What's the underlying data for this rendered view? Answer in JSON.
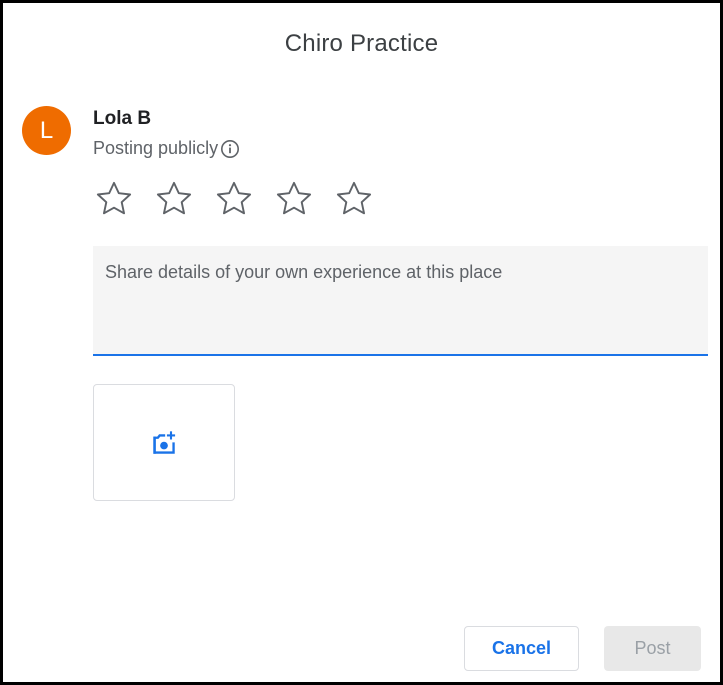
{
  "dialog": {
    "title": "Chiro Practice"
  },
  "user": {
    "avatar_initial": "L",
    "avatar_color": "#ef6c00",
    "name": "Lola B",
    "posting_label": "Posting publicly"
  },
  "rating": {
    "max": 5,
    "value": 0,
    "star_icon": "star-outline-icon"
  },
  "review": {
    "value": "",
    "placeholder": "Share details of your own experience at this place"
  },
  "photo": {
    "icon": "add-photo-icon"
  },
  "actions": {
    "cancel_label": "Cancel",
    "post_label": "Post"
  },
  "colors": {
    "accent": "#1a73e8",
    "text_secondary": "#5f6368",
    "disabled_bg": "#e8e8e8",
    "disabled_text": "#9aa0a6"
  }
}
